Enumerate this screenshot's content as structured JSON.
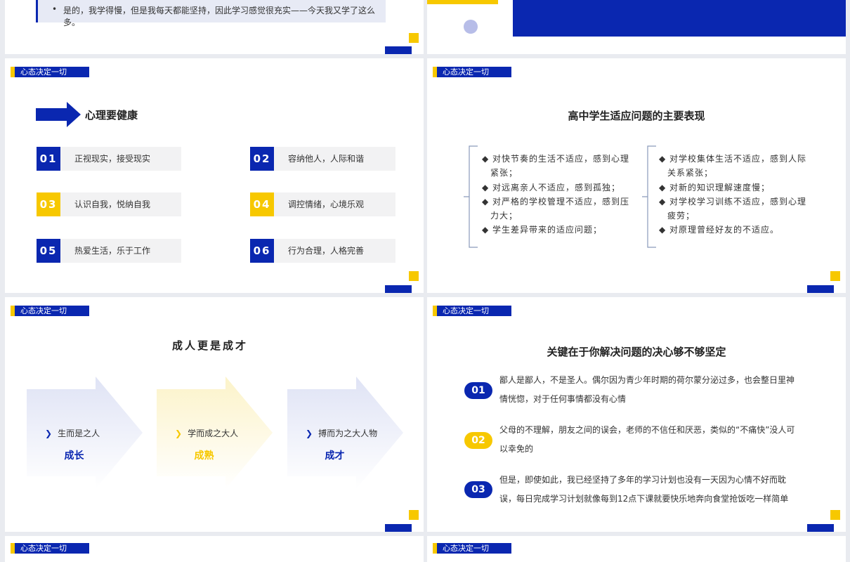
{
  "slide_top_left": {
    "quote": "是的，我学得慢，但是我每天都能坚持，因此学习感觉很充实——今天我又学了这么多。"
  },
  "slide_health": {
    "tag": "心态决定一切",
    "heading": "心理要健康",
    "items": [
      {
        "num": "01",
        "text": "正视现实，接受现实",
        "color": "blue"
      },
      {
        "num": "02",
        "text": "容纳他人，人际和谐",
        "color": "blue"
      },
      {
        "num": "03",
        "text": "认识自我，悦纳自我",
        "color": "yellow"
      },
      {
        "num": "04",
        "text": "调控情绪，心境乐观",
        "color": "yellow"
      },
      {
        "num": "05",
        "text": "热爱生活，乐于工作",
        "color": "blue"
      },
      {
        "num": "06",
        "text": "行为合理，人格完善",
        "color": "blue"
      }
    ]
  },
  "slide_adapt": {
    "tag": "心态决定一切",
    "heading": "高中学生适应问题的主要表现",
    "left": [
      "◆ 对快节奏的生活不适应，感到心理紧张；",
      "◆ 对远离亲人不适应，感到孤独；",
      "◆ 对严格的学校管理不适应，感到压力大；",
      "◆ 学生差异带来的适应问题；"
    ],
    "right": [
      "◆ 对学校集体生活不适应，感到人际关系紧张；",
      "◆ 对新的知识理解速度慢；",
      "◆ 对学校学习训练不适应，感到心理疲劳；",
      "◆ 对原理曾经好友的不适应。"
    ]
  },
  "slide_adult": {
    "tag": "心态决定一切",
    "heading": "成人更是成才",
    "cards": [
      {
        "label": "生而是之人",
        "big": "成长",
        "color": "#0a27b0",
        "bg": "#e3e7f6"
      },
      {
        "label": "学而成之大人",
        "big": "成熟",
        "color": "#f7c800",
        "bg": "#fdf6d6"
      },
      {
        "label": "搏而为之大人物",
        "big": "成才",
        "color": "#0a27b0",
        "bg": "#e3e7f6"
      }
    ]
  },
  "slide_resolve": {
    "tag": "心态决定一切",
    "heading": "关键在于你解决问题的决心够不够坚定",
    "items": [
      {
        "num": "01",
        "color": "blue",
        "text": "鄙人是鄙人，不是圣人。偶尔因为青少年时期的荷尔蒙分泌过多，也会整日里神情恍惚，对于任何事情都没有心情"
      },
      {
        "num": "02",
        "color": "yellow",
        "text": "父母的不理解，朋友之间的误会，老师的不信任和厌恶，类似的“不痛快”没人可以幸免的"
      },
      {
        "num": "03",
        "color": "blue",
        "text": "但是，即使如此，我已经坚持了多年的学习计划也没有一天因为心情不好而耽误，每日完成学习计划就像每到12点下课就要快乐地奔向食堂抢饭吃一样简单"
      }
    ]
  },
  "slide_bottom_left": {
    "tag": "心态决定一切"
  },
  "slide_bottom_right": {
    "tag": "心态决定一切"
  }
}
